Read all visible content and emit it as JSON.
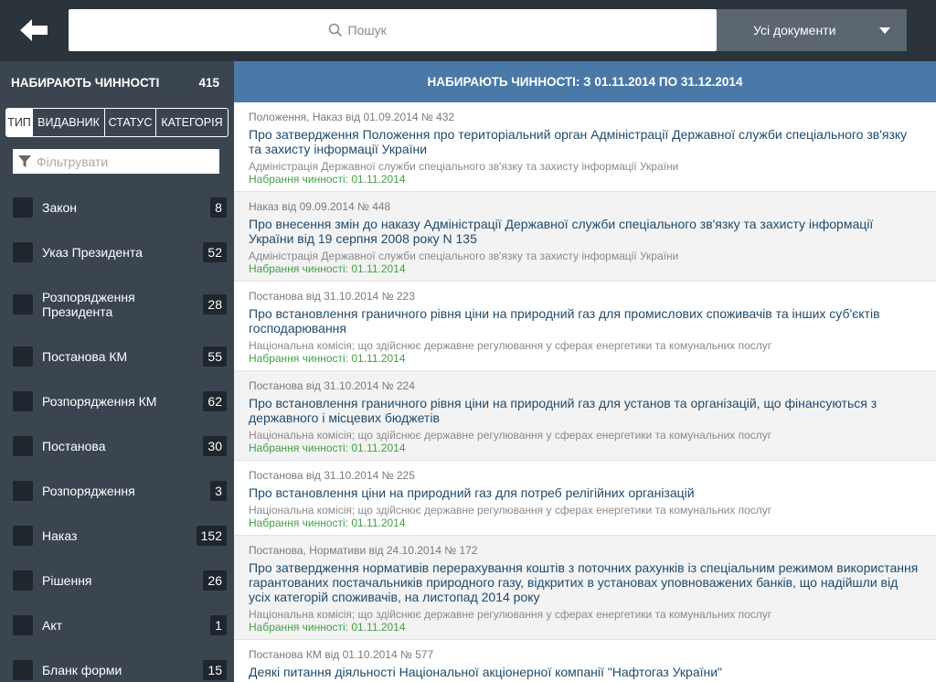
{
  "topbar": {
    "search_placeholder": "Пошук",
    "doc_filter": "Усі документи"
  },
  "sidebar": {
    "heading": "НАБИРАЮТЬ ЧИННОСТІ",
    "total": "415",
    "tabs": [
      "ТИП",
      "ВИДАВНИК",
      "СТАТУС",
      "КАТЕГОРІЯ"
    ],
    "active_tab": "ТИП",
    "filter_placeholder": "Фільтрувати",
    "items": [
      {
        "label": "Закон",
        "count": "8"
      },
      {
        "label": "Указ Президента",
        "count": "52"
      },
      {
        "label": "Розпорядження Президента",
        "count": "28"
      },
      {
        "label": "Постанова КМ",
        "count": "55"
      },
      {
        "label": "Розпорядження КМ",
        "count": "62"
      },
      {
        "label": "Постанова",
        "count": "30"
      },
      {
        "label": "Розпорядження",
        "count": "3"
      },
      {
        "label": "Наказ",
        "count": "152"
      },
      {
        "label": "Рішення",
        "count": "26"
      },
      {
        "label": "Акт",
        "count": "1"
      },
      {
        "label": "Бланк форми",
        "count": "15"
      }
    ]
  },
  "main": {
    "heading": "НАБИРАЮТЬ ЧИННОСТІ: З 01.11.2014 ПО 31.12.2014",
    "documents": [
      {
        "meta": "Положення, Наказ  від 01.09.2014  № 432",
        "title": "Про затвердження Положення про територіальний орган Адміністрації Державної служби спеціального зв'язку та захисту інформації України",
        "issuer": "Адміністрація Державної служби спеціального зв'язку та захисту інформації України",
        "effective": "Набрання чинності: 01.11.2014"
      },
      {
        "meta": "Наказ  від 09.09.2014  № 448",
        "title": "Про внесення змін до наказу Адміністрації Державної служби спеціального зв'язку та захисту інформації України від 19 серпня 2008 року N 135",
        "issuer": "Адміністрація Державної служби спеціального зв'язку та захисту інформації України",
        "effective": "Набрання чинності: 01.11.2014"
      },
      {
        "meta": "Постанова  від 31.10.2014  № 223",
        "title": "Про встановлення граничного рівня ціни на природний газ для промислових споживачів та інших суб'єктів господарювання",
        "issuer": "Національна комісія; що здійснює державне регулювання у сферах енергетики та комунальних послуг",
        "effective": "Набрання чинності: 01.11.2014"
      },
      {
        "meta": "Постанова  від 31.10.2014  № 224",
        "title": "Про встановлення граничного рівня ціни на природний газ для установ та організацій, що фінансуються з державного і місцевих бюджетів",
        "issuer": "Національна комісія; що здійснює державне регулювання у сферах енергетики та комунальних послуг",
        "effective": "Набрання чинності: 01.11.2014"
      },
      {
        "meta": "Постанова  від 31.10.2014  № 225",
        "title": "Про встановлення ціни на природний газ для потреб релігійних організацій",
        "issuer": "Національна комісія; що здійснює державне регулювання у сферах енергетики та комунальних послуг",
        "effective": "Набрання чинності: 01.11.2014"
      },
      {
        "meta": "Постанова, Нормативи  від 24.10.2014  № 172",
        "title": "Про затвердження нормативів перерахування коштів з поточних рахунків із спеціальним режимом використання гарантованих постачальників природного газу, відкритих в установах уповноважених банків, що надійшли від усіх категорій споживачів, на листопад 2014 року",
        "issuer": "Національна комісія; що здійснює державне регулювання у сферах енергетики та комунальних послуг",
        "effective": "Набрання чинності: 01.11.2014"
      },
      {
        "meta": "Постанова КМ  від 01.10.2014  № 577",
        "title": "Деякі питання діяльності Національної акціонерної компанії \"Нафтогаз України\"",
        "issuer": "",
        "effective": ""
      }
    ]
  },
  "icons": {
    "back": "arrow-left-icon",
    "search": "search-icon",
    "caret": "chevron-down-icon",
    "filter": "funnel-icon",
    "checkbox": "checkbox-icon"
  },
  "colors": {
    "topbar": "#2b333b",
    "sidebar": "#3a4550",
    "header_blue": "#4a79a8",
    "title_text": "#1f4a6b",
    "effective_green": "#43a047"
  }
}
